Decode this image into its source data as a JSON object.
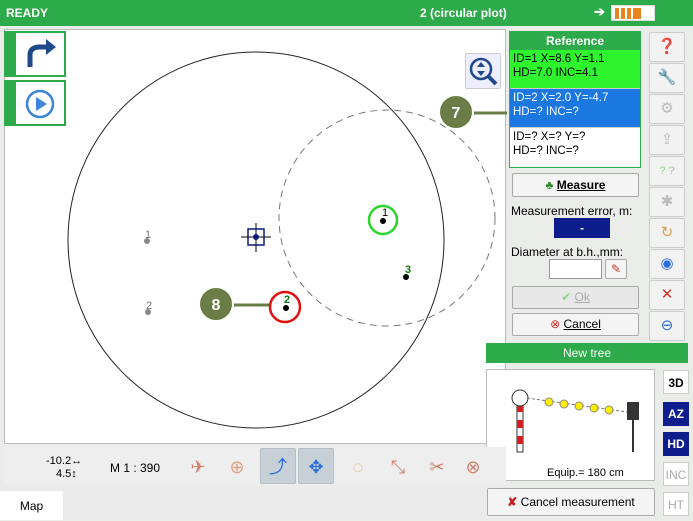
{
  "titlebar": {
    "status": "READY",
    "plot_name": "2 (circular plot)"
  },
  "callouts": {
    "a": "7",
    "b": "8"
  },
  "plot_points": [
    {
      "id": "1",
      "kind": "gray"
    },
    {
      "id": "2",
      "kind": "gray"
    },
    {
      "id": "1",
      "kind": "green-ring"
    },
    {
      "id": "2",
      "kind": "red-ring"
    },
    {
      "id": "3",
      "kind": "black"
    }
  ],
  "reference": {
    "title": "Reference",
    "rows": [
      {
        "line1": "ID=1  X=8.6  Y=1.1",
        "line2": "HD=7.0  INC=4.1"
      },
      {
        "line1": "ID=2  X=2.0  Y=-4.7",
        "line2": "HD=?  INC=?"
      },
      {
        "line1": "ID=?  X=?  Y=?",
        "line2": "HD=?  INC=?"
      }
    ]
  },
  "measure_label": "Measure",
  "error_label": "Measurement error, m:",
  "error_value": "-",
  "diameter_label": "Diameter at b.h.,mm:",
  "diameter_value": "",
  "ok_label": "Ok",
  "cancel_label": "Cancel",
  "new_tree": {
    "title": "New tree",
    "equip": "Equip.= 180 cm"
  },
  "modes": [
    "3D",
    "AZ",
    "HD",
    "INC",
    "HT"
  ],
  "cancel_measurement": "Cancel measurement",
  "coords": {
    "x": "-10.2",
    "y": "4.5"
  },
  "scale": "M 1 : 390",
  "tabs": {
    "map": "Map"
  },
  "colors": {
    "accent": "#2daa4a",
    "selected_row": "#1a78e0",
    "ok_row": "#2ef42e",
    "navy": "#0d1e8c"
  }
}
